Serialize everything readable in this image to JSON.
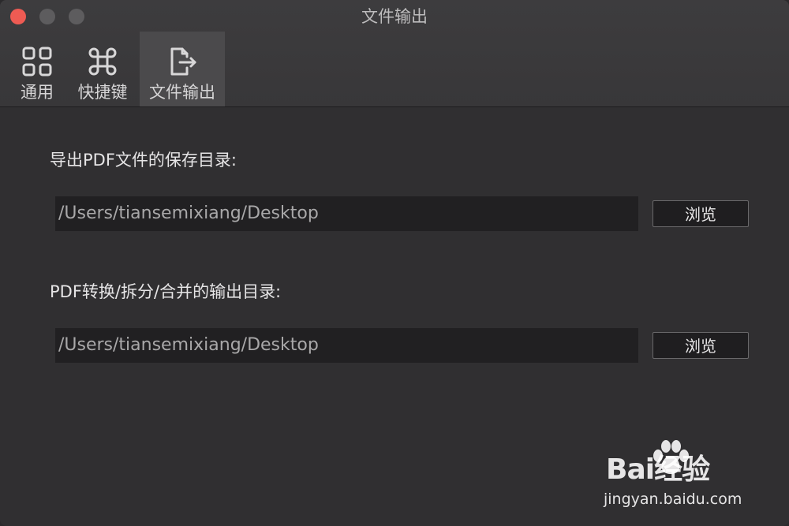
{
  "window": {
    "title": "文件输出"
  },
  "toolbar": {
    "items": [
      {
        "label": "通用",
        "icon": "grid-icon"
      },
      {
        "label": "快捷键",
        "icon": "command-icon"
      },
      {
        "label": "文件输出",
        "icon": "file-export-icon"
      }
    ],
    "active_index": 2
  },
  "settings": {
    "pdf_save_label": "导出PDF文件的保存目录:",
    "pdf_save_path": "/Users/tiansemixiang/Desktop",
    "output_label": "PDF转换/拆分/合并的输出目录:",
    "output_path": "/Users/tiansemixiang/Desktop",
    "browse_label": "浏览"
  },
  "watermark": {
    "logo_text": "Bai经验",
    "url": "jingyan.baidu.com"
  },
  "colors": {
    "close": "#ee5b53",
    "background": "#302f31",
    "field": "#212022"
  }
}
